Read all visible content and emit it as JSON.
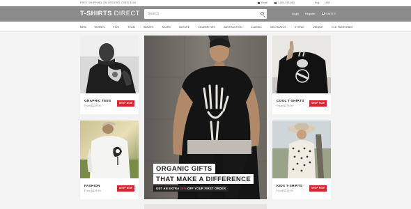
{
  "topbar": {
    "shipping": "FREE SHIPPING ON ORDERS OVER $100",
    "contact": [
      "Email",
      "1-800-975-890"
    ],
    "account": [
      "Eng",
      "USD"
    ]
  },
  "header": {
    "logo_bold": "T-SHIRTS",
    "logo_light": "DIRECT",
    "search_placeholder": "Search",
    "login": "Login",
    "register": "Register",
    "cart": "CART 0"
  },
  "nav": {
    "items": [
      "MEN",
      "WOMEN",
      "KIDS",
      "TEAM",
      "IMAGES",
      "STARS",
      "NATURE",
      "CELEBRITIES",
      "ABSTRACTION",
      "CLASSIC",
      "MECHANICS",
      "ETHNIC",
      "UNIQUE",
      "OLD FASHIONED"
    ]
  },
  "cards": [
    {
      "name": "GRAPHIC TEES",
      "price": "From $129.99",
      "button": "SHOP NOW"
    },
    {
      "name": "COOL T-SHIRTS",
      "price": "From $279.99",
      "button": "SHOP NOW"
    },
    {
      "name": "FASHION",
      "price": "From $429.99",
      "button": "SHOP NOW"
    },
    {
      "name": "KIDS T-SHIRTS",
      "price": "From $219.99",
      "button": "SHOP NOW"
    }
  ],
  "hero": {
    "line1": "ORGANIC GIFTS",
    "line2": "THAT MAKE A DIFFERENCE",
    "promo_prefix": "GET AN EXTRA",
    "promo_highlight": "10%",
    "promo_suffix": "OFF YOUR FIRST ORDER"
  },
  "colors": {
    "header_bg": "#8c8c8c",
    "accent_red": "#d7262f",
    "page_bg": "#f3f3f3"
  }
}
